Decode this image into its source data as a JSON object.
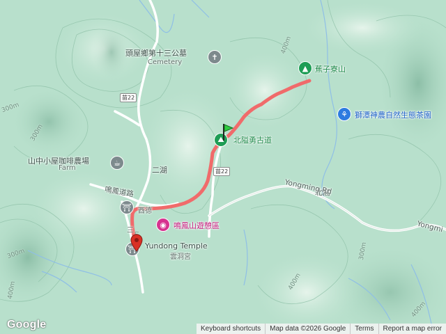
{
  "colors": {
    "terrain": "#b8e0cc",
    "route": "#f06b6b",
    "road": "#ffffff",
    "river": "#8fbfe6"
  },
  "places": {
    "cemetery_zh": "頭屋鄉第十三公墓",
    "cemetery_en": "Cemetery",
    "cafe_zh": "山中小屋咖啡農場",
    "cafe_en": "Farm",
    "erhu": "二湖",
    "mingfeng_road": "鳴鳳道路",
    "temple_mark": "酉德",
    "mingfeng_park": "鳴鳳山遊憩區",
    "yundong_temple_en": "Yundong Temple",
    "yundong_temple_zh": "雲洞宮",
    "sanmark": "三",
    "beiai_trail": "北隘勇古道",
    "jiaoziliao_shan": "蕉子寮山",
    "shitan_park": "獅潭神農自然生態茶園",
    "beiwo": "北窩",
    "yongming_rd": "Yongming Rd",
    "yongming_rd_2": "Yongmi"
  },
  "shields": {
    "route_a": "苗22",
    "route_b": "苗22"
  },
  "contours": [
    "400m",
    "300m",
    "300m",
    "400m",
    "300m",
    "300m",
    "400m",
    "400m",
    "400m"
  ],
  "icons": {
    "cemetery": "cemetery-icon",
    "cafe": "cafe-icon",
    "temple": "temple-icon",
    "park": "camera-icon",
    "trail": "hiking-icon",
    "peak": "mountain-icon",
    "farm": "farm-icon",
    "start": "start-flag-icon",
    "end": "end-marker-icon"
  },
  "footer": {
    "logo": "Google",
    "shortcuts": "Keyboard shortcuts",
    "mapdata": "Map data ©2026 Google",
    "terms": "Terms",
    "report": "Report a map error"
  }
}
